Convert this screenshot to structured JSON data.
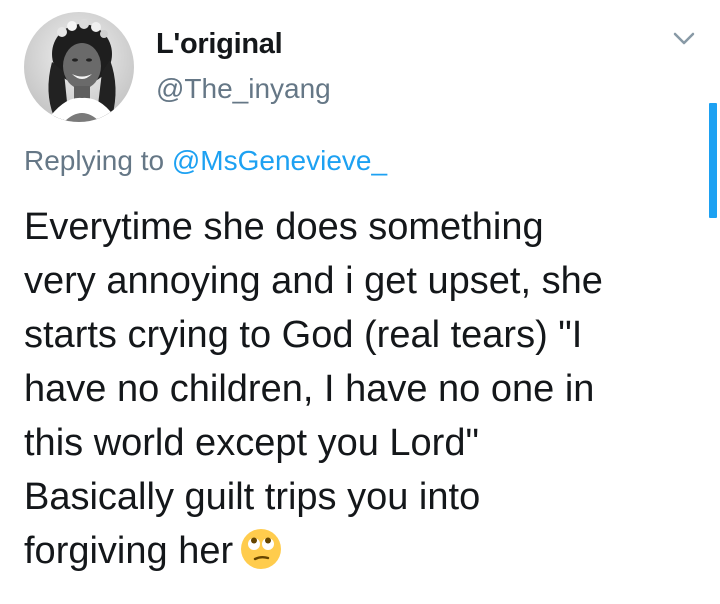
{
  "tweet": {
    "display_name": "L'original",
    "handle": "@The_inyang",
    "reply_prefix": "Replying to",
    "reply_to": "@MsGenevieve_",
    "text_lines": [
      "Everytime she does something",
      "very annoying and i get upset, she",
      "starts crying to God (real tears) \"I",
      "have no children, I have no one in",
      "this world except you Lord\"",
      "Basically guilt trips you into",
      "forgiving her"
    ],
    "emoji": "face-with-rolling-eyes-icon"
  },
  "colors": {
    "text": "#14171a",
    "secondary": "#657786",
    "accent": "#1da1f2",
    "background": "#ffffff"
  }
}
